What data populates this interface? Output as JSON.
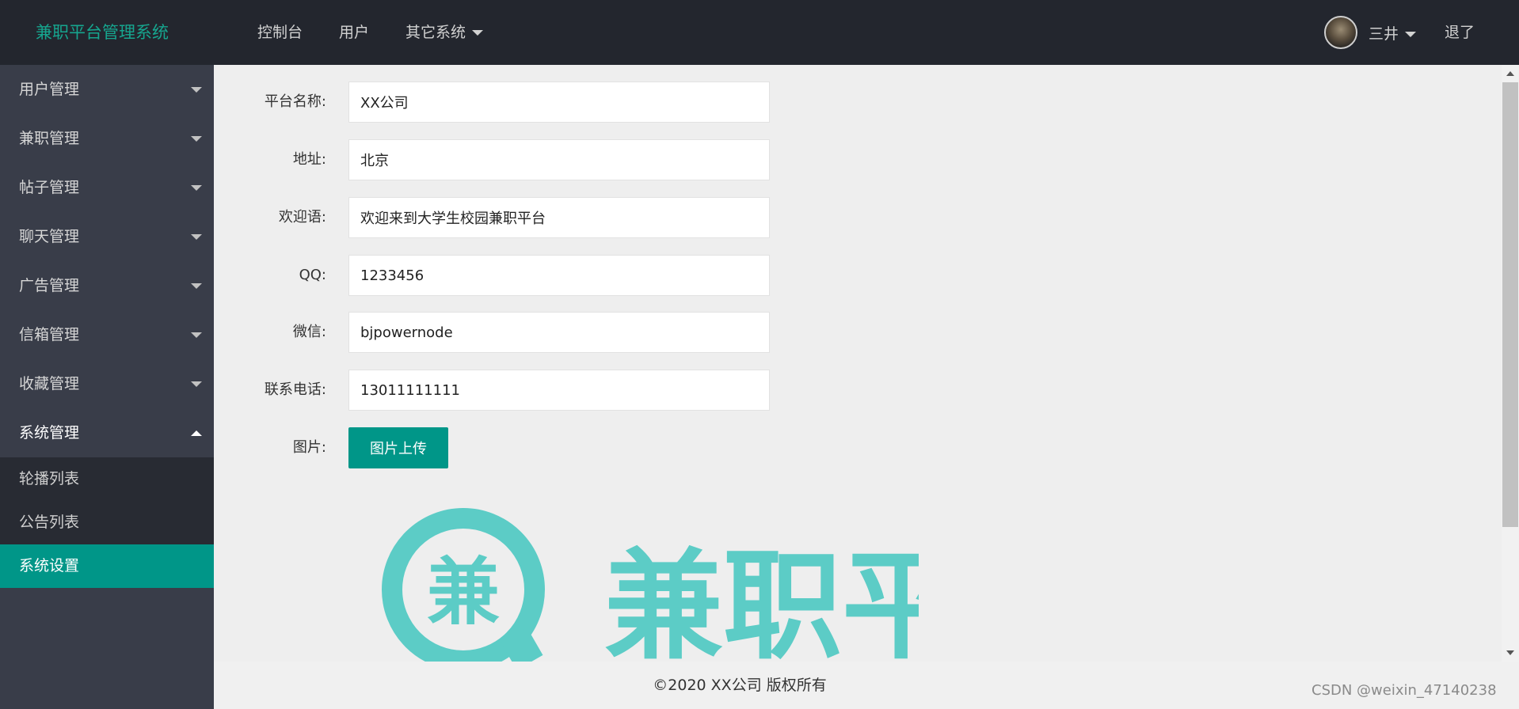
{
  "header": {
    "logo": "兼职平台管理系统",
    "nav": [
      "控制台",
      "用户",
      "其它系统"
    ],
    "username": "三井",
    "logout": "退了"
  },
  "sidebar": {
    "items": [
      {
        "label": "用户管理"
      },
      {
        "label": "兼职管理"
      },
      {
        "label": "帖子管理"
      },
      {
        "label": "聊天管理"
      },
      {
        "label": "广告管理"
      },
      {
        "label": "信箱管理"
      },
      {
        "label": "收藏管理"
      },
      {
        "label": "系统管理"
      }
    ],
    "sub_items": [
      "轮播列表",
      "公告列表",
      "系统设置"
    ],
    "active": "系统设置"
  },
  "form": {
    "fields": [
      {
        "label": "平台名称:",
        "value": "XX公司"
      },
      {
        "label": "地址:",
        "value": "北京"
      },
      {
        "label": "欢迎语:",
        "value": "欢迎来到大学生校园兼职平台"
      },
      {
        "label": "QQ:",
        "value": "1233456"
      },
      {
        "label": "微信:",
        "value": "bjpowernode"
      },
      {
        "label": "联系电话:",
        "value": "13011111111"
      }
    ],
    "image_label": "图片:",
    "upload_button": "图片上传"
  },
  "banner": {
    "icon_char": "兼",
    "text": "兼职平台"
  },
  "footer": "©2020 XX公司 版权所有",
  "watermark": "CSDN @weixin_47140238",
  "colors": {
    "header_bg": "#23262e",
    "sidebar_bg": "#393d49",
    "submenu_bg": "#282b33",
    "accent": "#009688",
    "logo_color": "#16a68f",
    "banner_color": "#5cccc6"
  }
}
